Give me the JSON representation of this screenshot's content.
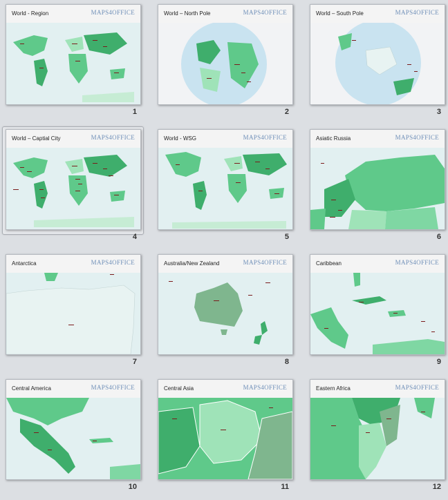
{
  "slides": [
    {
      "title": "World - Region",
      "logo": "MAPS4OFFICE",
      "number": "1"
    },
    {
      "title": "World – North Pole",
      "logo": "MAPS4OFFICE",
      "number": "2"
    },
    {
      "title": "World – South Pole",
      "logo": "MAPS4OFFICE",
      "number": "3"
    },
    {
      "title": "World – Captial City",
      "logo": "MAPS4OFFICE",
      "number": "4"
    },
    {
      "title": "World - WSG",
      "logo": "MAPS4OFFICE",
      "number": "5"
    },
    {
      "title": "Asiatic Russia",
      "logo": "MAPS4OFFICE",
      "number": "6"
    },
    {
      "title": "Antarctica",
      "logo": "MAPS4OFFICE",
      "number": "7"
    },
    {
      "title": "Australia/New Zealand",
      "logo": "MAPS4OFFICE",
      "number": "8"
    },
    {
      "title": "Caribbean",
      "logo": "MAPS4OFFICE",
      "number": "9"
    },
    {
      "title": "Central America",
      "logo": "MAPS4OFFICE",
      "number": "10",
      "ghost": "hcco"
    },
    {
      "title": "Central Asia",
      "logo": "MAPS4OFFICE",
      "number": "11"
    },
    {
      "title": "Eastern Africa",
      "logo": "MAPS4OFFICE",
      "number": "12"
    }
  ],
  "selected_slide": "4",
  "colors": {
    "land": "#5fc98a",
    "land_dark": "#3fae6c",
    "land_light": "#9fe3b8",
    "ocean": "#e2f0f1",
    "label": "#7a1a1a"
  }
}
